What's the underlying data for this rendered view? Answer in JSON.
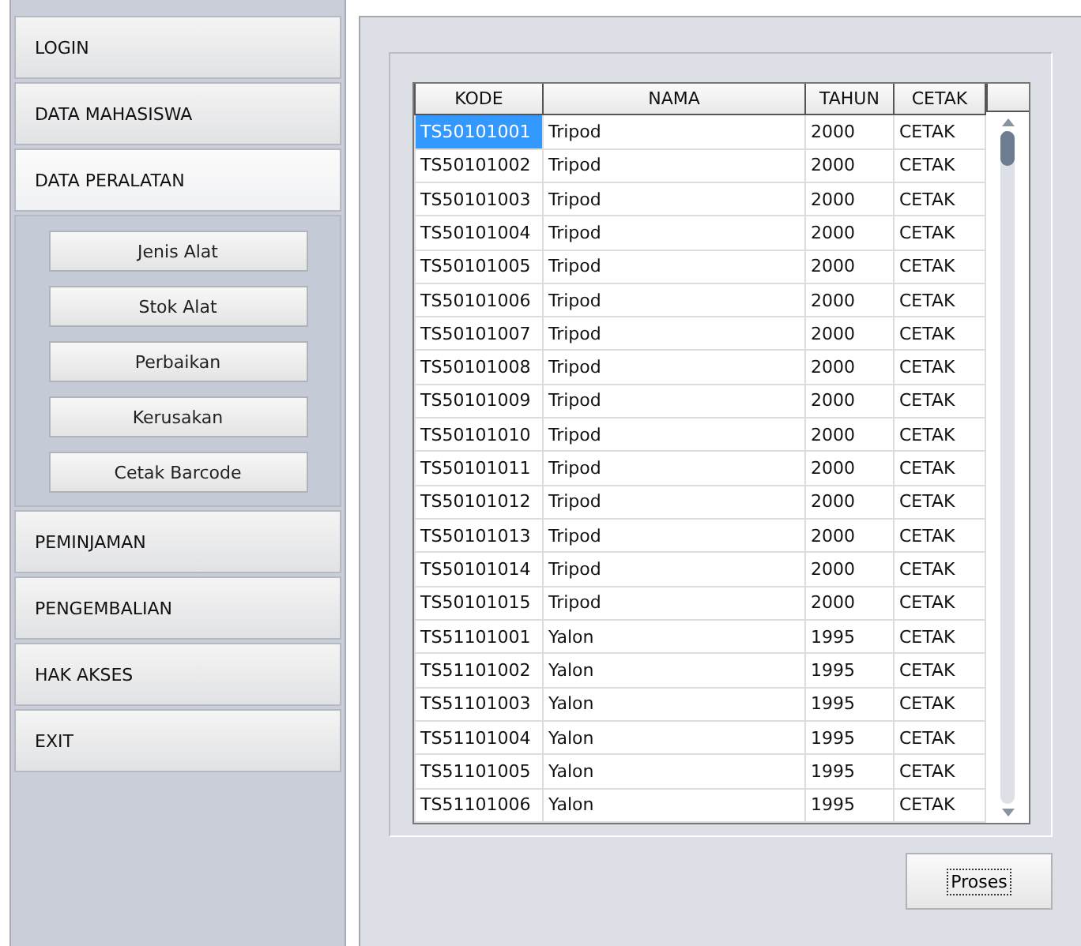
{
  "sidebar": {
    "items": [
      {
        "label": "LOGIN",
        "selected": false
      },
      {
        "label": "DATA MAHASISWA",
        "selected": false
      },
      {
        "label": "DATA PERALATAN",
        "selected": true,
        "children": [
          "Jenis Alat",
          "Stok Alat",
          "Perbaikan",
          "Kerusakan",
          "Cetak Barcode"
        ]
      },
      {
        "label": "PEMINJAMAN",
        "selected": false
      },
      {
        "label": "PENGEMBALIAN",
        "selected": false
      },
      {
        "label": "HAK AKSES",
        "selected": false
      },
      {
        "label": "EXIT",
        "selected": false
      }
    ]
  },
  "table": {
    "columns": [
      "KODE",
      "NAMA",
      "TAHUN",
      "CETAK"
    ],
    "rows": [
      {
        "cells": [
          "TS50101001",
          "Tripod",
          "2000",
          "CETAK"
        ],
        "selected": true
      },
      {
        "cells": [
          "TS50101002",
          "Tripod",
          "2000",
          "CETAK"
        ],
        "selected": false
      },
      {
        "cells": [
          "TS50101003",
          "Tripod",
          "2000",
          "CETAK"
        ],
        "selected": false
      },
      {
        "cells": [
          "TS50101004",
          "Tripod",
          "2000",
          "CETAK"
        ],
        "selected": false
      },
      {
        "cells": [
          "TS50101005",
          "Tripod",
          "2000",
          "CETAK"
        ],
        "selected": false
      },
      {
        "cells": [
          "TS50101006",
          "Tripod",
          "2000",
          "CETAK"
        ],
        "selected": false
      },
      {
        "cells": [
          "TS50101007",
          "Tripod",
          "2000",
          "CETAK"
        ],
        "selected": false
      },
      {
        "cells": [
          "TS50101008",
          "Tripod",
          "2000",
          "CETAK"
        ],
        "selected": false
      },
      {
        "cells": [
          "TS50101009",
          "Tripod",
          "2000",
          "CETAK"
        ],
        "selected": false
      },
      {
        "cells": [
          "TS50101010",
          "Tripod",
          "2000",
          "CETAK"
        ],
        "selected": false
      },
      {
        "cells": [
          "TS50101011",
          "Tripod",
          "2000",
          "CETAK"
        ],
        "selected": false
      },
      {
        "cells": [
          "TS50101012",
          "Tripod",
          "2000",
          "CETAK"
        ],
        "selected": false
      },
      {
        "cells": [
          "TS50101013",
          "Tripod",
          "2000",
          "CETAK"
        ],
        "selected": false
      },
      {
        "cells": [
          "TS50101014",
          "Tripod",
          "2000",
          "CETAK"
        ],
        "selected": false
      },
      {
        "cells": [
          "TS50101015",
          "Tripod",
          "2000",
          "CETAK"
        ],
        "selected": false
      },
      {
        "cells": [
          "TS51101001",
          "Yalon",
          "1995",
          "CETAK"
        ],
        "selected": false
      },
      {
        "cells": [
          "TS51101002",
          "Yalon",
          "1995",
          "CETAK"
        ],
        "selected": false
      },
      {
        "cells": [
          "TS51101003",
          "Yalon",
          "1995",
          "CETAK"
        ],
        "selected": false
      },
      {
        "cells": [
          "TS51101004",
          "Yalon",
          "1995",
          "CETAK"
        ],
        "selected": false
      },
      {
        "cells": [
          "TS51101005",
          "Yalon",
          "1995",
          "CETAK"
        ],
        "selected": false
      },
      {
        "cells": [
          "TS51101006",
          "Yalon",
          "1995",
          "CETAK"
        ],
        "selected": false
      }
    ]
  },
  "button": "Proses"
}
